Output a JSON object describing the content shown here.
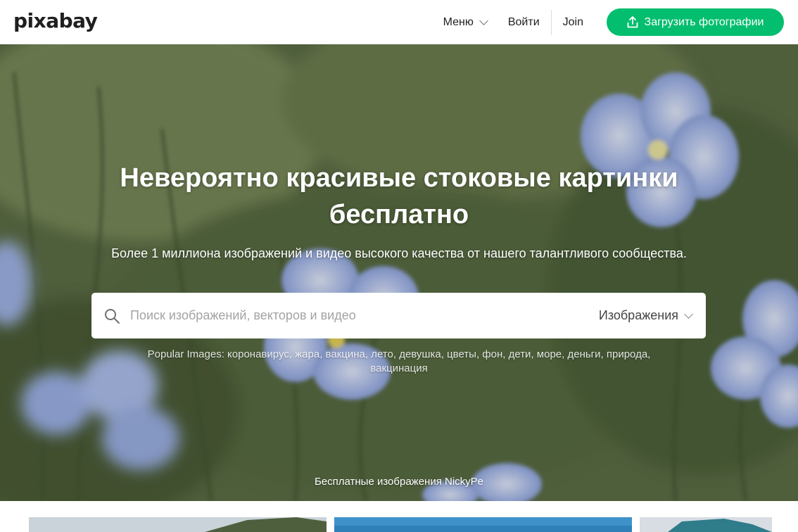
{
  "header": {
    "logo": "pixabay",
    "menu_label": "Меню",
    "login_label": "Войти",
    "join_label": "Join",
    "upload_label": "Загрузить фотографии"
  },
  "hero": {
    "title_line1": "Невероятно красивые стоковые картинки",
    "title_line2": "бесплатно",
    "subtitle": "Более 1 миллиона изображений и видео высокого качества от нашего талантливого сообщества.",
    "search": {
      "placeholder": "Поиск изображений, векторов и видео",
      "value": "",
      "type_selected": "Изображения"
    },
    "popular_label": "Popular Images:",
    "popular_tags": [
      "коронавирус",
      "жара",
      "вакцина",
      "лето",
      "девушка",
      "цветы",
      "фон",
      "дети",
      "море",
      "деньги",
      "природа",
      "вакцинация"
    ],
    "credit": "Бесплатные изображения NickyPe"
  },
  "icons": {
    "upload": "upload-icon",
    "search": "search-icon",
    "menu_chevron": "chevron-down-icon",
    "type_chevron": "chevron-down-icon"
  },
  "colors": {
    "accent": "#02be6e",
    "header_bg": "#ffffff",
    "hero_text": "#ffffff"
  }
}
